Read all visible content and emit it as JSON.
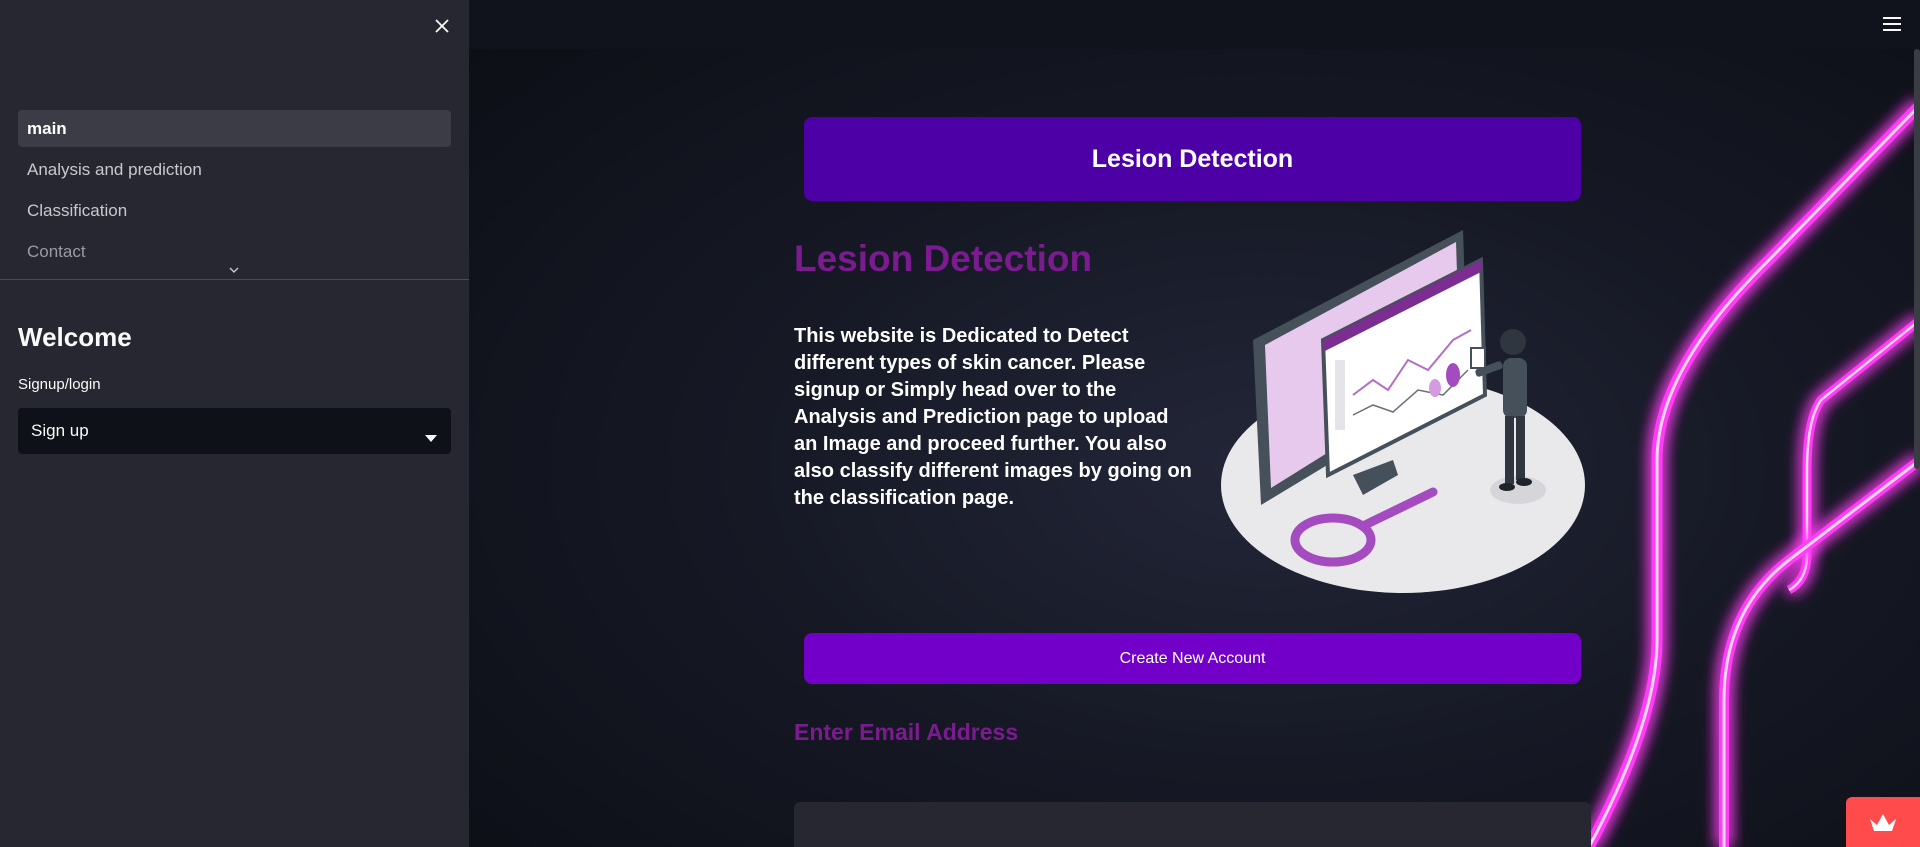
{
  "sidebar": {
    "nav_items": [
      {
        "label": "main",
        "active": true
      },
      {
        "label": "Analysis and prediction",
        "active": false
      },
      {
        "label": "Classification",
        "active": false
      },
      {
        "label": "Contact",
        "active": false
      }
    ],
    "welcome_title": "Welcome",
    "select_label": "Signup/login",
    "select_value": "Sign up",
    "icons": [
      "close-icon",
      "chevron-down-icon",
      "caret-down-icon"
    ]
  },
  "main": {
    "banner_title": "Lesion Detection",
    "heading": "Lesion Detection",
    "intro": "This website is Dedicated to Detect different types of skin cancer. Please signup or Simply head over to the Analysis and Prediction page to upload an Image and proceed further. You also also classify different images by going on the classification page.",
    "create_button": "Create New Account",
    "email_label": "Enter Email Address",
    "email_value": ""
  },
  "colors": {
    "sidebar_bg": "#262730",
    "banner": "#4c00a6",
    "button": "#7200c9",
    "heading": "#7b1b8f",
    "neon": "#ff3df5",
    "badge": "#ff4b4b"
  }
}
